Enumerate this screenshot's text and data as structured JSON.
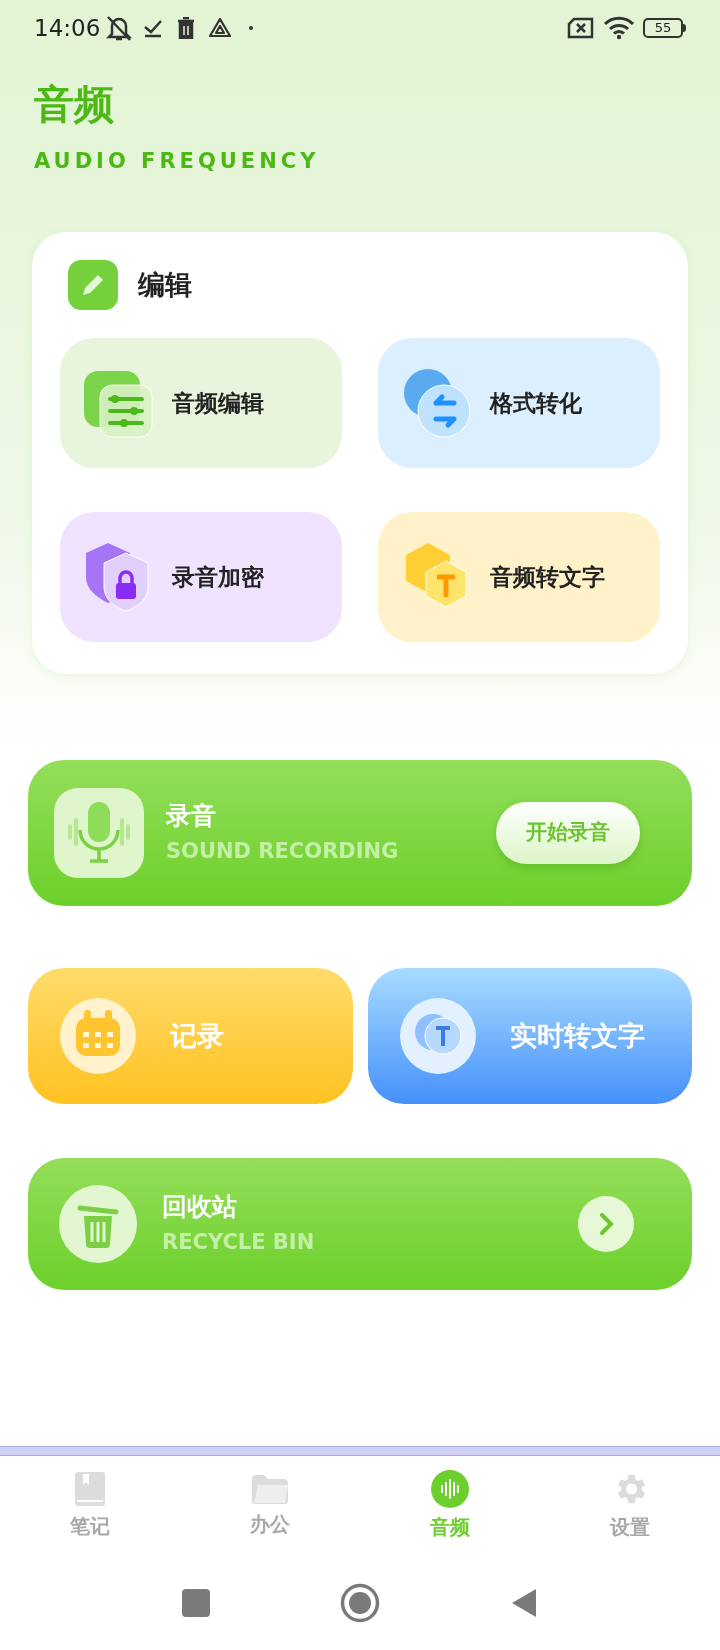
{
  "status_bar": {
    "time": "14:06",
    "battery": "55"
  },
  "header": {
    "title": "音频",
    "subtitle": "AUDIO FREQUENCY"
  },
  "edit_card": {
    "title": "编辑",
    "tools": [
      {
        "label": "音频编辑",
        "kind": "sliders"
      },
      {
        "label": "格式转化",
        "kind": "convert"
      },
      {
        "label": "录音加密",
        "kind": "lock"
      },
      {
        "label": "音频转文字",
        "kind": "text"
      }
    ]
  },
  "recording": {
    "title": "录音",
    "subtitle": "SOUND RECORDING",
    "button": "开始录音"
  },
  "shortcuts": [
    {
      "label": "记录",
      "kind": "calendar"
    },
    {
      "label": "实时转文字",
      "kind": "transcribe"
    }
  ],
  "recycle": {
    "title": "回收站",
    "subtitle": "RECYCLE BIN"
  },
  "tabs": [
    {
      "label": "笔记",
      "kind": "book",
      "selected": false
    },
    {
      "label": "办公",
      "kind": "folder",
      "selected": false
    },
    {
      "label": "音频",
      "kind": "audio",
      "selected": true
    },
    {
      "label": "设置",
      "kind": "gear",
      "selected": false
    }
  ]
}
